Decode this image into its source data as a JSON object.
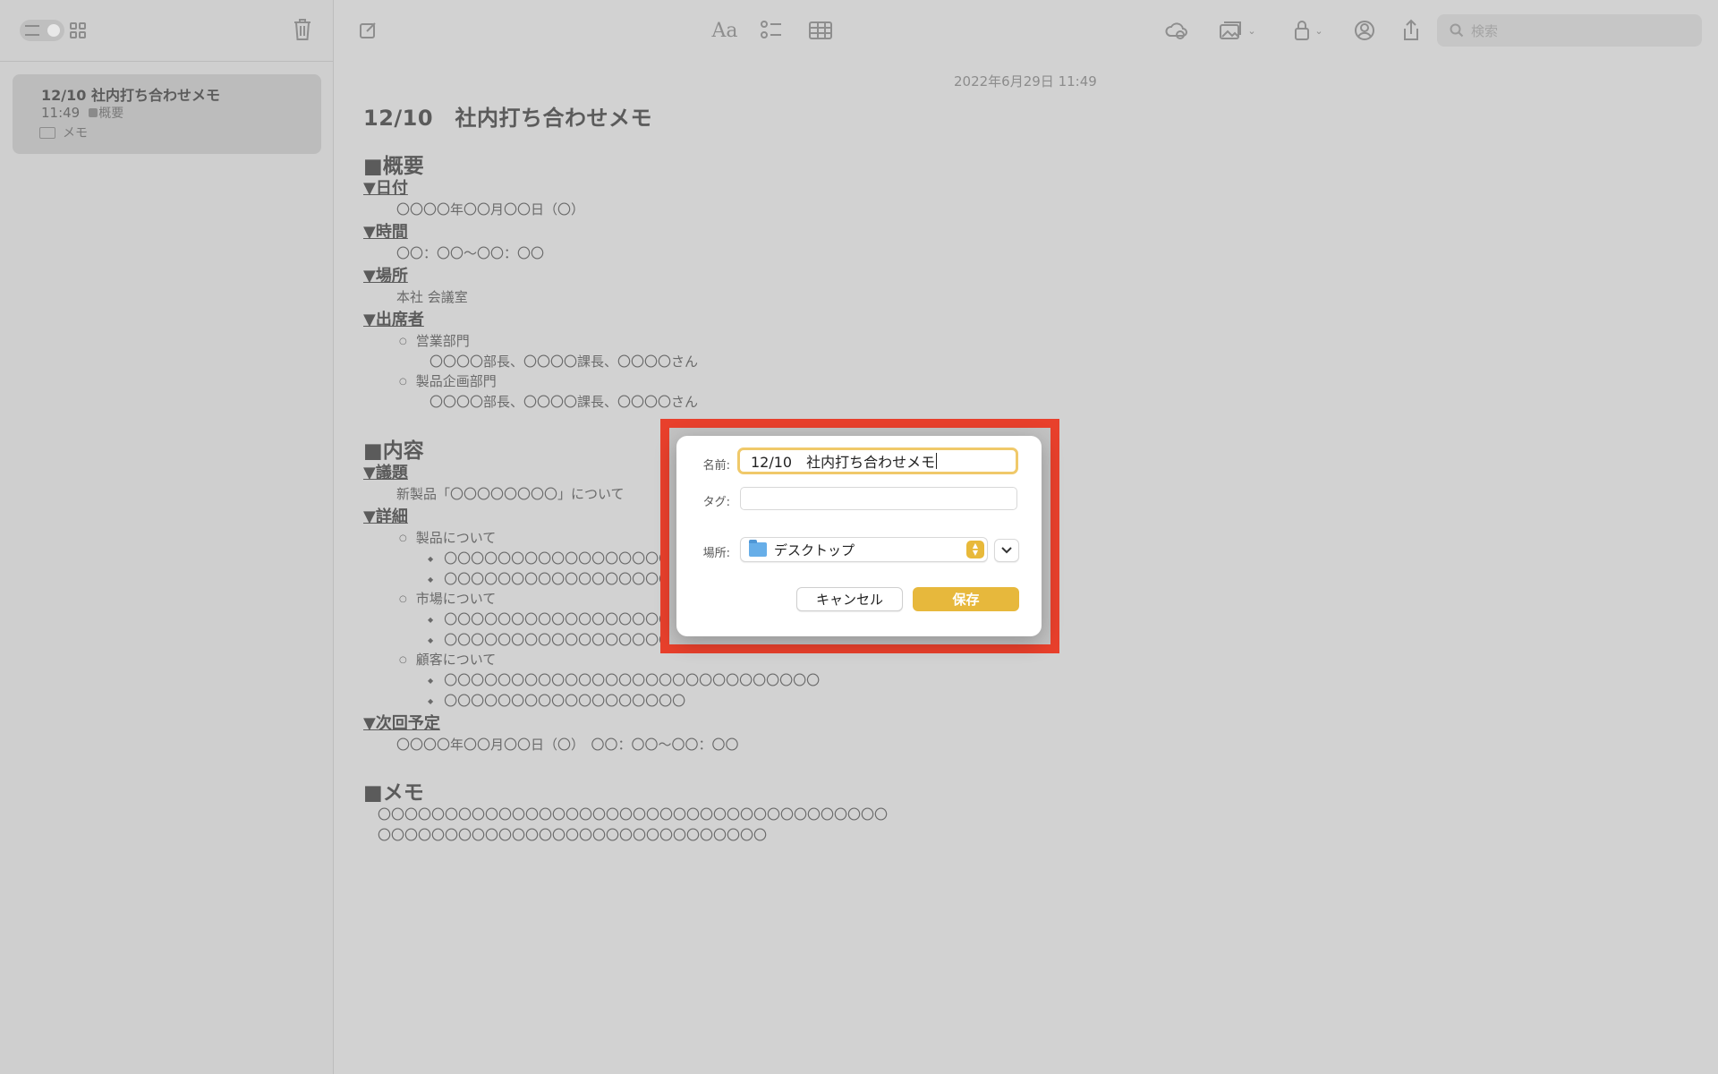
{
  "sidebar": {
    "note": {
      "title": "12/10 社内打ち合わせメモ",
      "time": "11:49",
      "tag": "概要",
      "folder": "メモ"
    }
  },
  "toolbar": {
    "format_label": "Aa",
    "search_placeholder": "検索"
  },
  "note": {
    "date": "2022年6月29日 11:49",
    "title": "12/10　社内打ち合わせメモ",
    "s_overview": "■概要",
    "h_date": "▼日付",
    "v_date": "〇〇〇〇年〇〇月〇〇日（〇）",
    "h_time": "▼時間",
    "v_time": "〇〇：〇〇〜〇〇：〇〇",
    "h_place": "▼場所",
    "v_place": "本社 会議室",
    "h_attendees": "▼出席者",
    "dept1": "営業部門",
    "dept1_members": "〇〇〇〇部長、〇〇〇〇課長、〇〇〇〇さん",
    "dept2": "製品企画部門",
    "dept2_members": "〇〇〇〇部長、〇〇〇〇課長、〇〇〇〇さん",
    "s_content": "■内容",
    "h_agenda": "▼議題",
    "v_agenda": "新製品「〇〇〇〇〇〇〇〇」について",
    "h_details": "▼詳細",
    "d1": "製品について",
    "d1_a": "〇〇〇〇〇〇〇〇〇〇〇〇〇〇〇〇〇〇〇〇〇〇〇〇〇〇〇〇〇〇〇〇",
    "d1_b": "〇〇〇〇〇〇〇〇〇〇〇〇〇〇〇〇〇〇〇〇〇〇〇〇〇〇〇〇〇",
    "d2": "市場について",
    "d2_a": "〇〇〇〇〇〇〇〇〇〇〇〇〇〇〇〇〇〇〇〇〇〇〇〇〇〇〇〇〇〇",
    "d2_b": "〇〇〇〇〇〇〇〇〇〇〇〇〇〇〇〇〇〇〇〇〇〇〇〇〇〇〇〇〇〇〇〇〇",
    "d3": "顧客について",
    "d3_a": "〇〇〇〇〇〇〇〇〇〇〇〇〇〇〇〇〇〇〇〇〇〇〇〇〇〇〇〇",
    "d3_b": "〇〇〇〇〇〇〇〇〇〇〇〇〇〇〇〇〇〇",
    "h_next": "▼次回予定",
    "v_next": "〇〇〇〇年〇〇月〇〇日（〇）　〇〇：〇〇〜〇〇：〇〇",
    "s_memo": "■メモ",
    "memo1": "〇〇〇〇〇〇〇〇〇〇〇〇〇〇〇〇〇〇〇〇〇〇〇〇〇〇〇〇〇〇〇〇〇〇〇〇〇〇",
    "memo2": "〇〇〇〇〇〇〇〇〇〇〇〇〇〇〇〇〇〇〇〇〇〇〇〇〇〇〇〇〇"
  },
  "dialog": {
    "name_label": "名前:",
    "name_value": "12/10　社内打ち合わせメモ",
    "tags_label": "タグ:",
    "tags_value": "",
    "location_label": "場所:",
    "location_value": "デスクトップ",
    "cancel_label": "キャンセル",
    "save_label": "保存"
  },
  "colors": {
    "highlight": "#e8402c",
    "accent": "#e7b83c",
    "focus_ring": "#f0c96a",
    "overlay": "#d2d2d2"
  }
}
